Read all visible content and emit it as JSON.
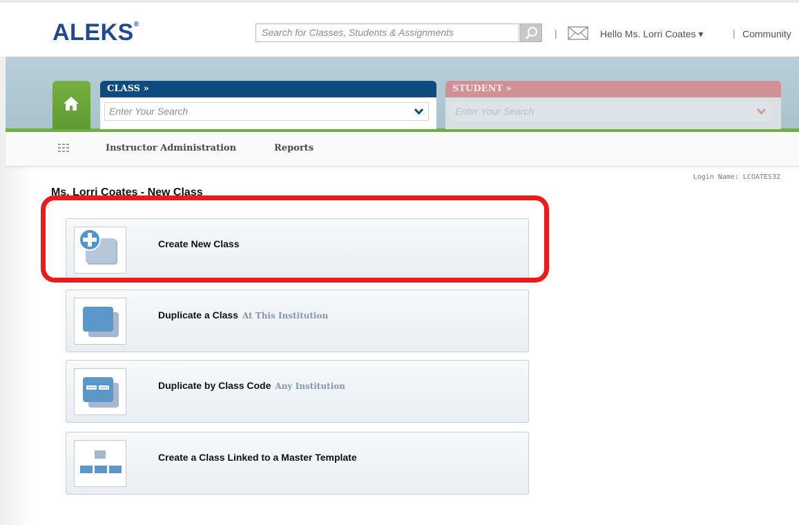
{
  "header": {
    "logo": "ALEKS",
    "logo_mark": "®",
    "search_placeholder": "Search for Classes, Students & Assignments",
    "separator": "|",
    "greeting": "Hello Ms. Lorri Coates ▾",
    "community": "Community"
  },
  "class_tab": {
    "heading": "CLASS »",
    "placeholder": "Enter Your Search"
  },
  "student_tab": {
    "heading": "STUDENT »",
    "placeholder": "Enter Your Search"
  },
  "nav": {
    "items": [
      "Instructor Administration",
      "Reports"
    ]
  },
  "login_name": "Login Name: LCOATES32",
  "page_title": "Ms. Lorri Coates - New Class",
  "options": [
    {
      "label": "Create New Class",
      "sub": ""
    },
    {
      "label": "Duplicate a Class",
      "sub": "At This Institution"
    },
    {
      "label": "Duplicate by Class Code",
      "sub": "Any Institution"
    },
    {
      "label": "Create a Class Linked to a Master Template",
      "sub": ""
    }
  ],
  "colors": {
    "brand_blue": "#1e4a8f",
    "class_header": "#0d4b7e",
    "student_header": "#cf9096",
    "home_green": "#6fae3f",
    "highlight_red": "#ee1a1a"
  }
}
